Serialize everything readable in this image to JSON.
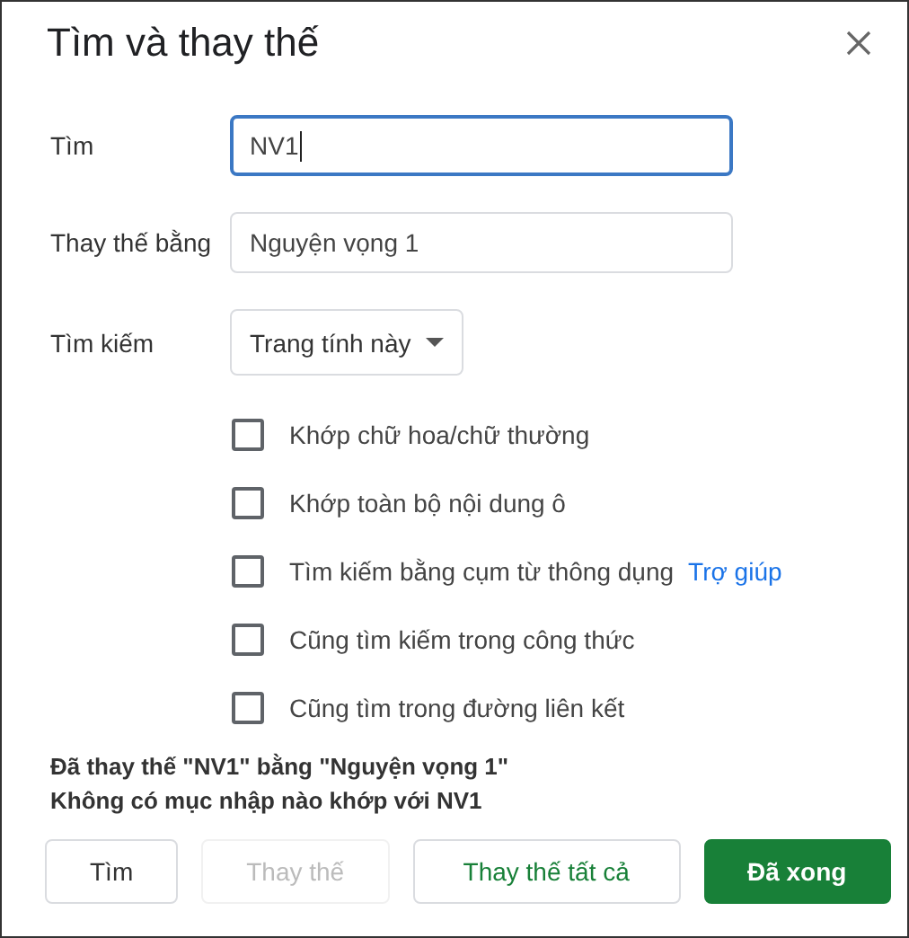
{
  "dialog": {
    "title": "Tìm và thay thế"
  },
  "fields": [
    {
      "label": "Tìm",
      "value": "NV1",
      "focused": true
    },
    {
      "label": "Thay thế bằng",
      "value": "Nguyện vọng 1",
      "focused": false
    }
  ],
  "scope": {
    "label": "Tìm kiếm",
    "value": "Trang tính này"
  },
  "options": [
    {
      "label": "Khớp chữ hoa/chữ thường",
      "checked": false
    },
    {
      "label": "Khớp toàn bộ nội dung ô",
      "checked": false
    },
    {
      "label": "Tìm kiếm bằng cụm từ thông dụng",
      "checked": false,
      "link": "Trợ giúp"
    },
    {
      "label": "Cũng tìm kiếm trong công thức",
      "checked": false
    },
    {
      "label": "Cũng tìm trong đường liên kết",
      "checked": false
    }
  ],
  "messages": [
    "Đã thay thế \"NV1\" bằng \"Nguyện vọng 1\"",
    "Không có mục nhập nào khớp với NV1"
  ],
  "buttons": [
    {
      "label": "Tìm",
      "kind": "outline",
      "disabled": false
    },
    {
      "label": "Thay thế",
      "kind": "outline",
      "disabled": true
    },
    {
      "label": "Thay thế tất cả",
      "kind": "outline-green",
      "disabled": false
    },
    {
      "label": "Đã xong",
      "kind": "primary",
      "disabled": false
    }
  ]
}
